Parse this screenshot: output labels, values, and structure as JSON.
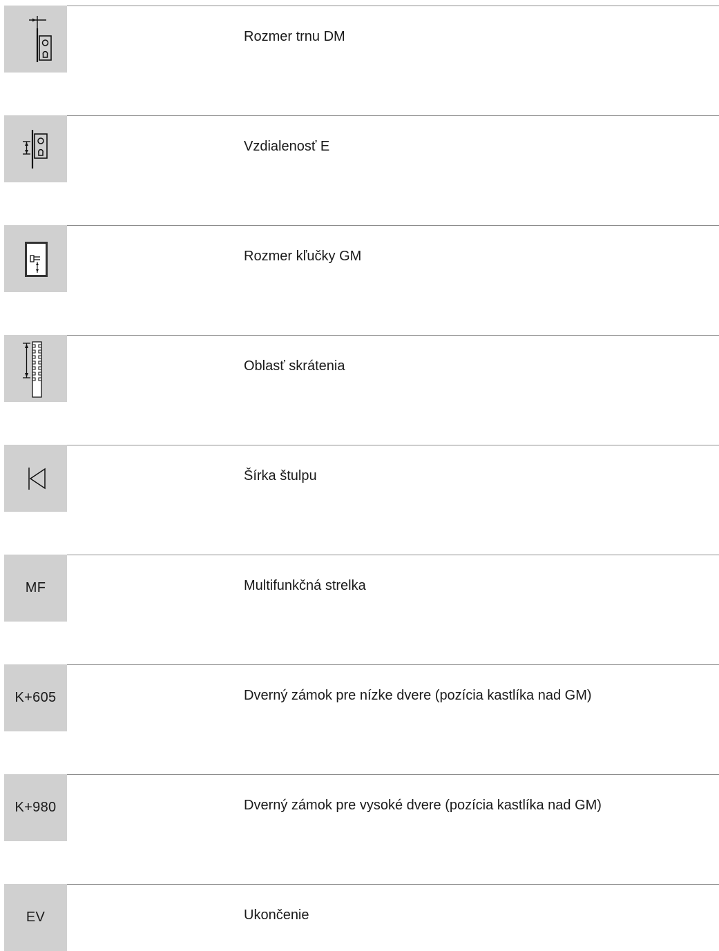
{
  "rows": [
    {
      "icon": "backset-icon",
      "code": "",
      "label": "Rozmer trnu DM"
    },
    {
      "icon": "distance-icon",
      "code": "",
      "label": "Vzdialenosť E"
    },
    {
      "icon": "handle-height-icon",
      "code": "",
      "label": "Rozmer kľučky GM"
    },
    {
      "icon": "shortening-range-icon",
      "code": "",
      "label": "Oblasť skrátenia"
    },
    {
      "icon": "faceplate-width-icon",
      "code": "",
      "label": "Šírka štulpu"
    },
    {
      "icon": "",
      "code": "MF",
      "label": "Multifunkčná strelka"
    },
    {
      "icon": "",
      "code": "K+605",
      "label": "Dverný zámok pre nízke dvere (pozícia kastlíka nad GM)"
    },
    {
      "icon": "",
      "code": "K+980",
      "label": "Dverný zámok pre vysoké dvere (pozícia kastlíka nad GM)"
    },
    {
      "icon": "",
      "code": "EV",
      "label": "Ukončenie"
    }
  ]
}
